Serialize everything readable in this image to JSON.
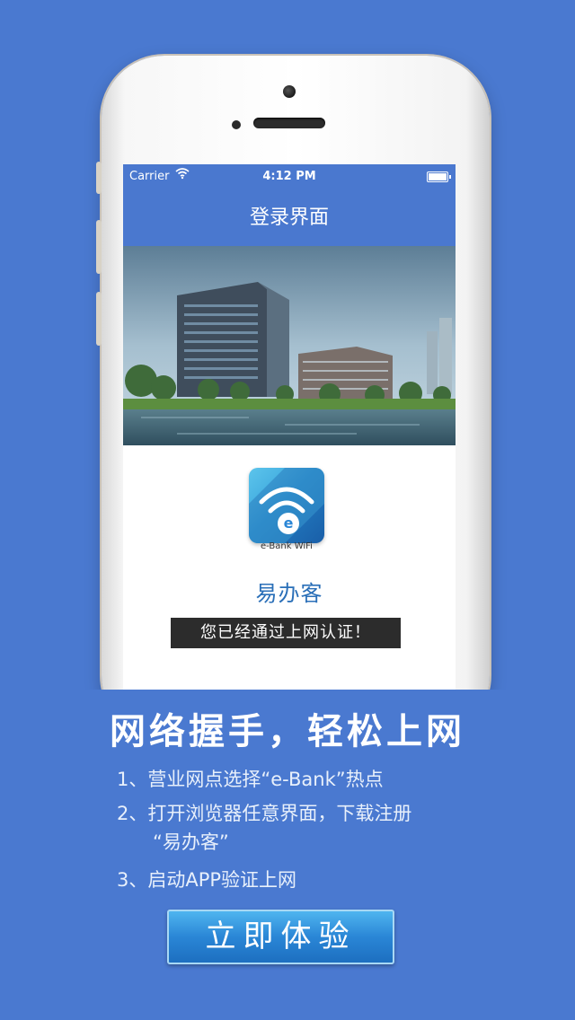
{
  "status_bar": {
    "carrier": "Carrier",
    "time": "4:12 PM"
  },
  "nav": {
    "title": "登录界面"
  },
  "app": {
    "icon_caption": "e-Bank WiFi",
    "name": "易办客"
  },
  "banner": {
    "message": "您已经通过上网认证！"
  },
  "promo": {
    "headline": "网络握手，轻松上网",
    "steps": [
      "1、营业网点选择“e-Bank”热点",
      "2、打开浏览器任意界面，下载注册",
      "“易办客”",
      "3、启动APP验证上网"
    ],
    "cta_label": "立即体验"
  },
  "colors": {
    "accent": "#4a78cf",
    "background": "#4a79d0",
    "cta": "#2a86d6",
    "app_title": "#2a6fb8"
  },
  "icons": [
    "wifi-icon",
    "battery-icon",
    "e-bank-wifi-logo-icon"
  ]
}
